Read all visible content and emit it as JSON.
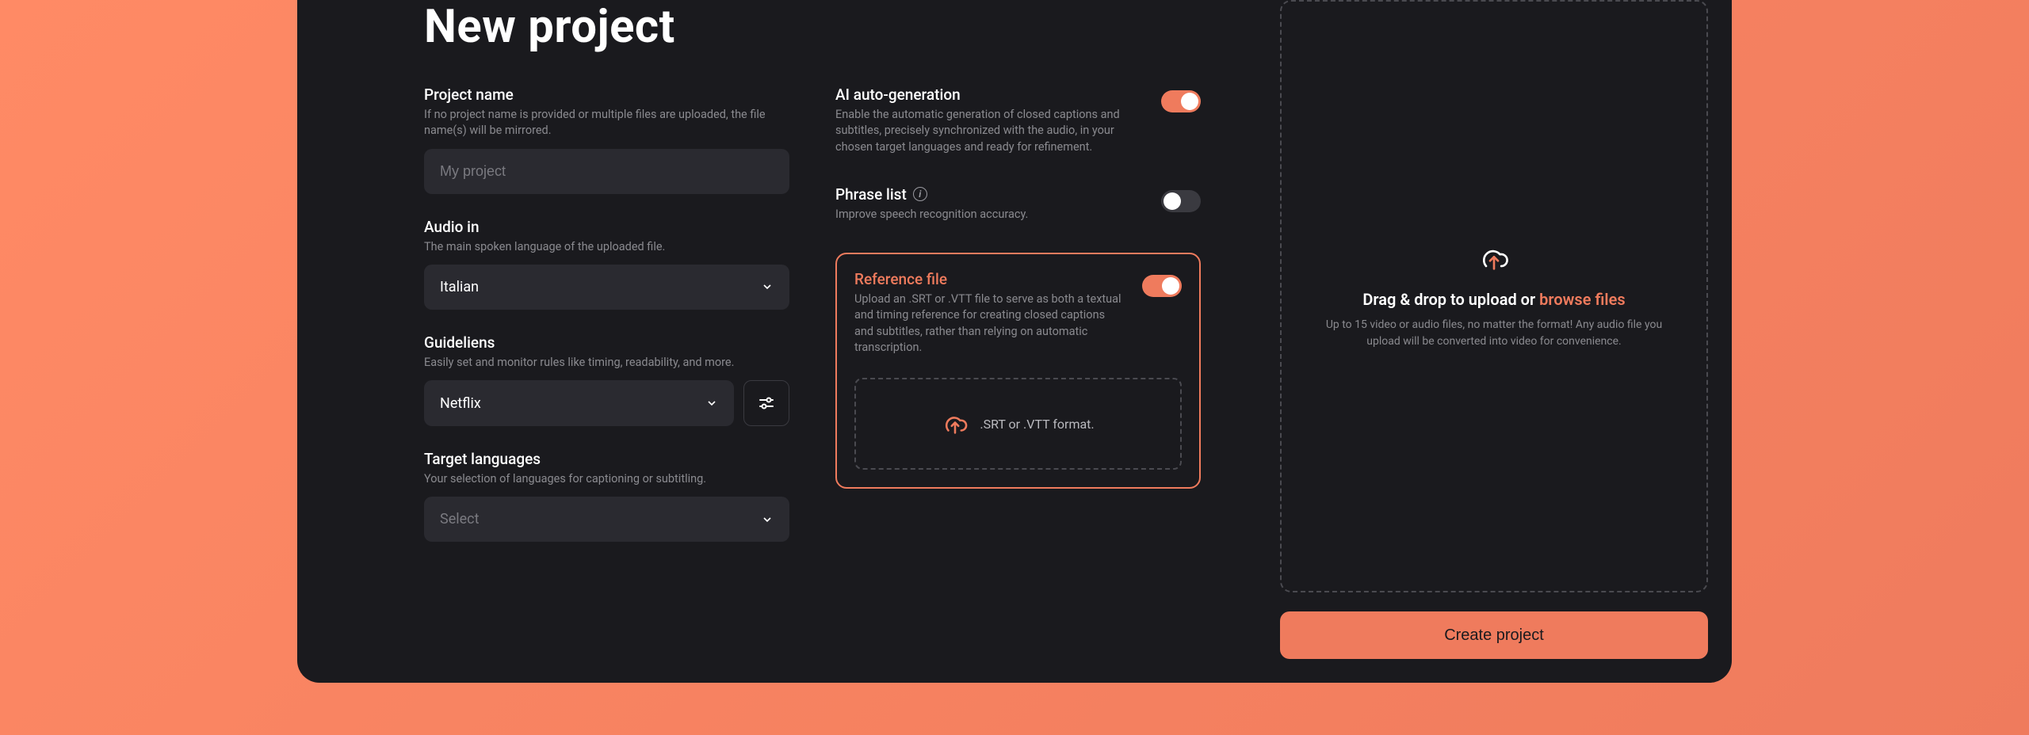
{
  "title": "New project",
  "projectName": {
    "label": "Project name",
    "desc": "If no project name is provided or multiple files are uploaded, the file name(s) will be mirrored.",
    "placeholder": "My project"
  },
  "audioIn": {
    "label": "Audio in",
    "desc": "The main spoken language of the uploaded file.",
    "value": "Italian"
  },
  "guidelines": {
    "label": "Guideliens",
    "desc": "Easily set and monitor rules like timing, readability, and more.",
    "value": "Netflix"
  },
  "targetLanguages": {
    "label": "Target languages",
    "desc": "Your selection of languages for captioning or subtitling.",
    "placeholder": "Select"
  },
  "aiAuto": {
    "label": "AI auto-generation",
    "desc": "Enable the automatic generation of closed captions and subtitles, precisely synchronized with the audio, in your chosen target languages and ready for refinement."
  },
  "phraseList": {
    "label": "Phrase list",
    "desc": "Improve speech recognition accuracy."
  },
  "referenceFile": {
    "label": "Reference file",
    "desc": "Upload an .SRT or .VTT file to serve as both a textual and timing reference for creating closed captions and subtitles, rather than relying on automatic transcription.",
    "dropText": ".SRT or .VTT format."
  },
  "upload": {
    "titlePrefix": "Drag & drop to upload or ",
    "titleLink": "browse files",
    "desc": "Up to 15 video or audio files, no matter the format! Any audio file you upload will be converted into video for convenience."
  },
  "createBtn": "Create project"
}
